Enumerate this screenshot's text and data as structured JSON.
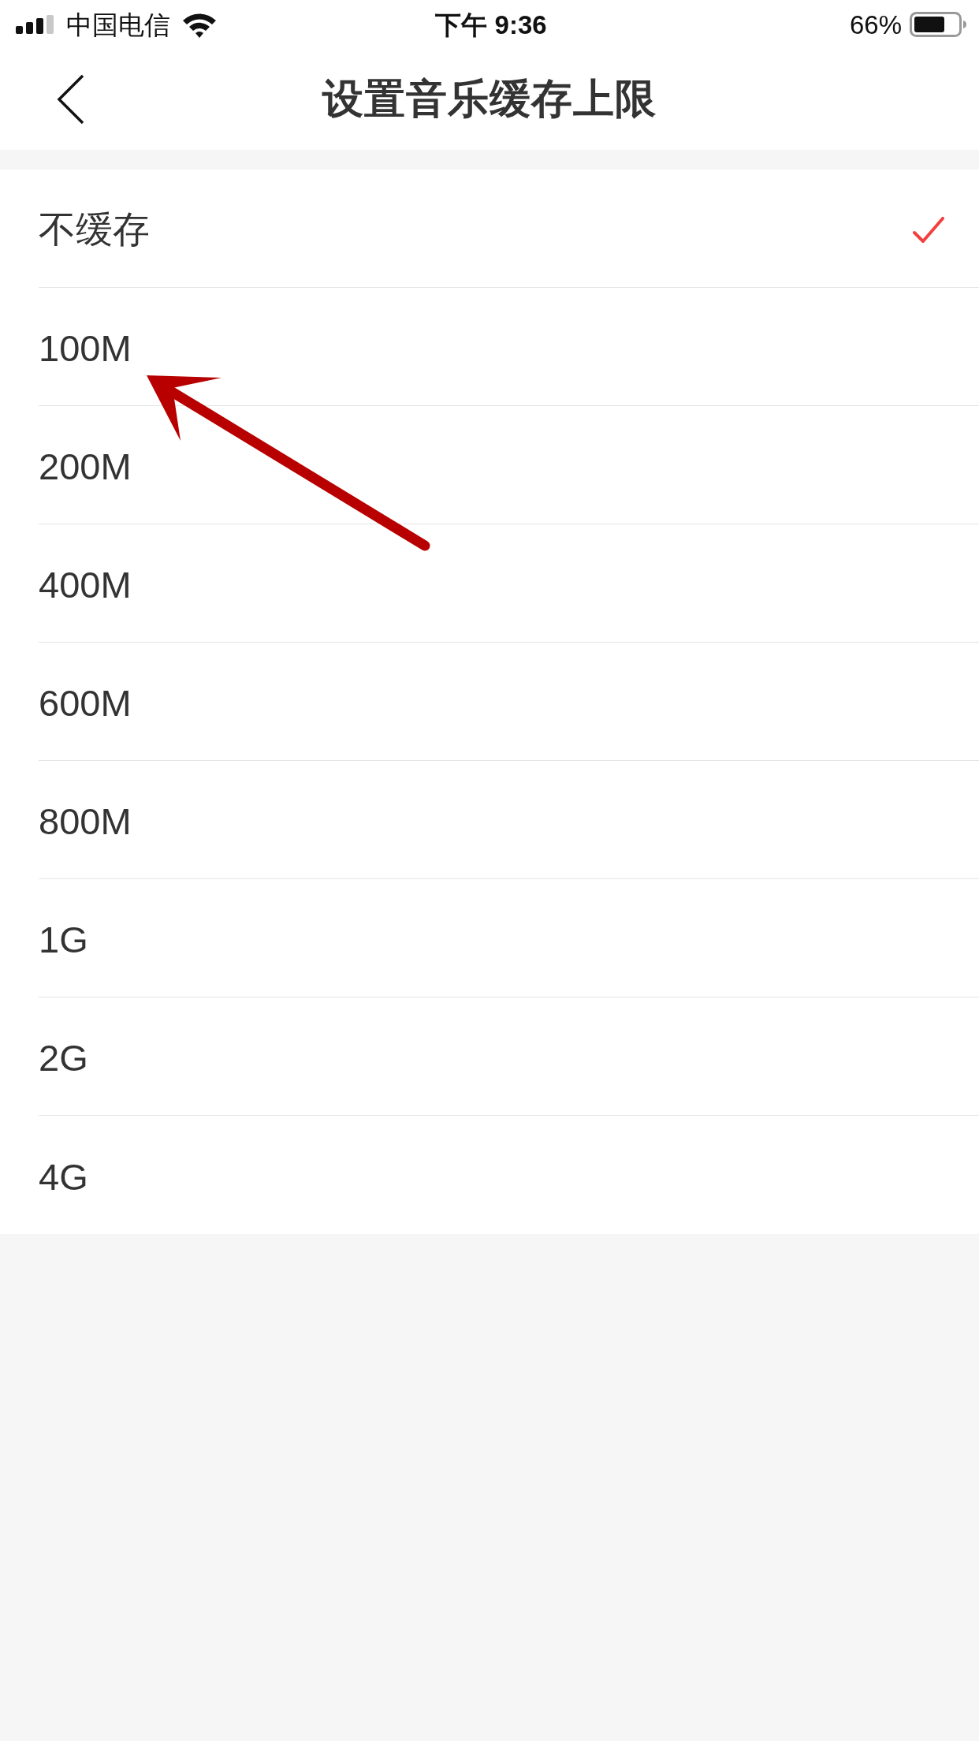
{
  "status_bar": {
    "carrier": "中国电信",
    "time": "下午 9:36",
    "battery_percent": "66%"
  },
  "nav_bar": {
    "title": "设置音乐缓存上限"
  },
  "options": [
    {
      "label": "不缓存",
      "selected": true
    },
    {
      "label": "100M",
      "selected": false
    },
    {
      "label": "200M",
      "selected": false
    },
    {
      "label": "400M",
      "selected": false
    },
    {
      "label": "600M",
      "selected": false
    },
    {
      "label": "800M",
      "selected": false
    },
    {
      "label": "1G",
      "selected": false
    },
    {
      "label": "2G",
      "selected": false
    },
    {
      "label": "4G",
      "selected": false
    }
  ]
}
